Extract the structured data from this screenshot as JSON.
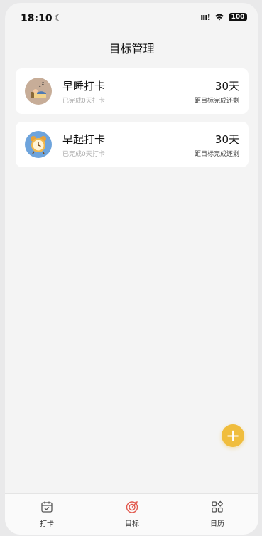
{
  "status_bar": {
    "time": "18:10",
    "moon_glyph": "☾",
    "signal": "ııı!",
    "battery": "100"
  },
  "page": {
    "title": "目标管理"
  },
  "goals": [
    {
      "icon": "sleep-icon",
      "title": "早睡打卡",
      "completed": "已完成0天打卡",
      "days": "30天",
      "note": "距目标完成还剩"
    },
    {
      "icon": "alarm-clock-icon",
      "title": "早起打卡",
      "completed": "已完成0天打卡",
      "days": "30天",
      "note": "距目标完成还剩"
    }
  ],
  "fab": {
    "label": "+"
  },
  "tabs": [
    {
      "label": "打卡",
      "icon": "calendar-check-icon",
      "active": false
    },
    {
      "label": "目标",
      "icon": "target-icon",
      "active": true
    },
    {
      "label": "日历",
      "icon": "grid-apps-icon",
      "active": false
    }
  ],
  "colors": {
    "accent": "#f0bd3d",
    "active_tab": "#e2574c",
    "background": "#f4f4f4"
  }
}
